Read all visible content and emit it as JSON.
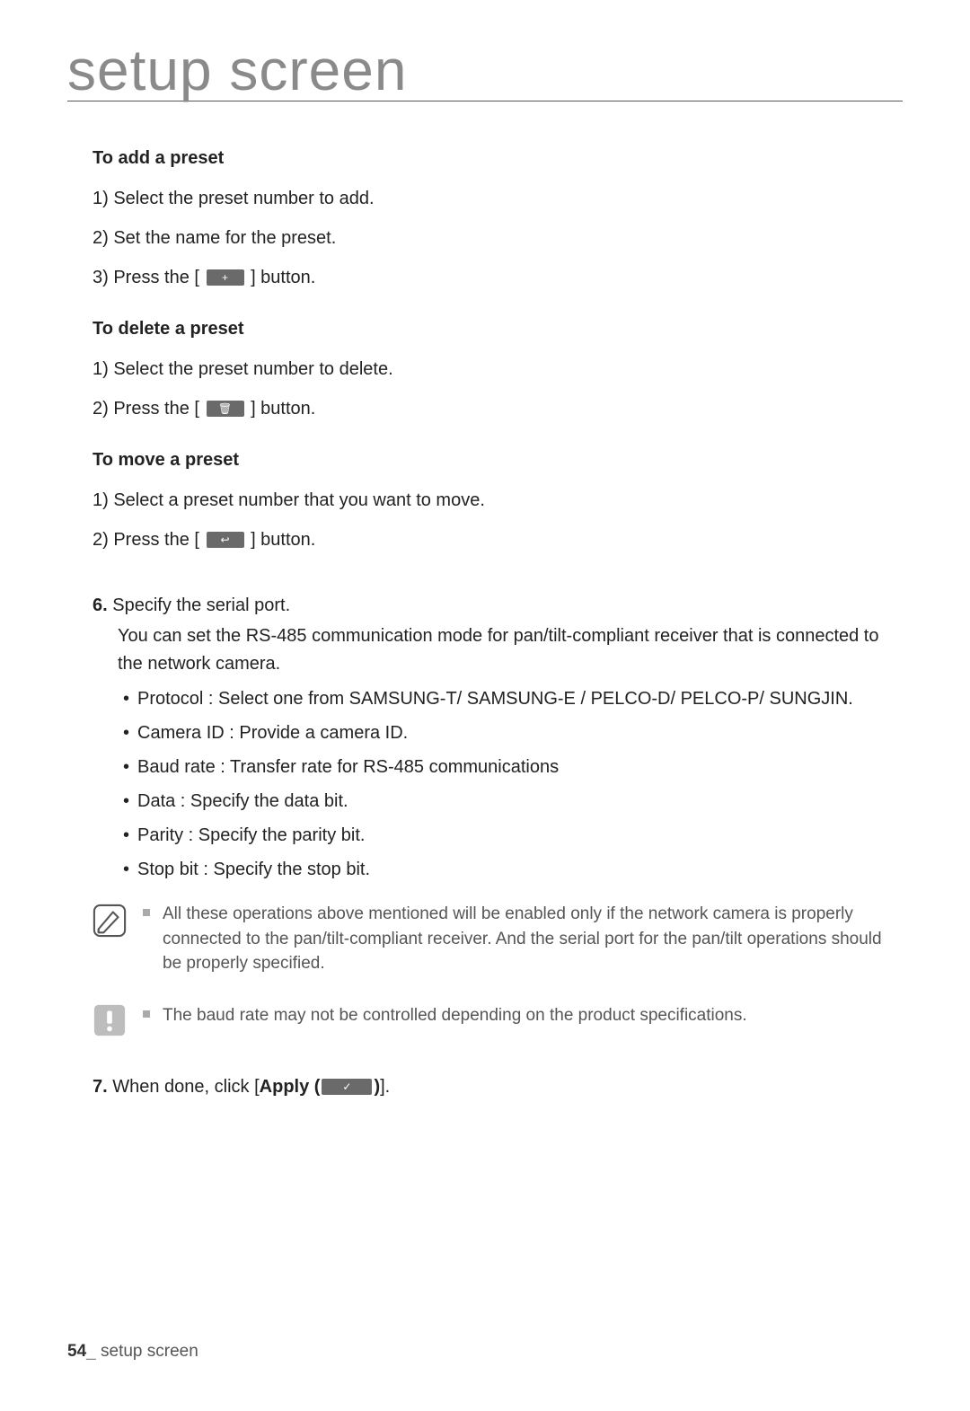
{
  "title": "setup screen",
  "sections": {
    "add": {
      "heading": "To add a preset",
      "steps": [
        "1) Select the preset number to add.",
        "2) Set the name for the preset.",
        "3) Press the [",
        "] button."
      ],
      "btn_glyph": "+"
    },
    "delete": {
      "heading": "To delete a preset",
      "steps": [
        "1) Select the preset number to delete.",
        "2) Press the [",
        "] button."
      ],
      "btn_glyph": "🗑"
    },
    "move": {
      "heading": "To move a preset",
      "steps": [
        "1) Select a preset number that you want to move.",
        "2) Press the [",
        "] button."
      ],
      "btn_glyph": "↩"
    }
  },
  "item6": {
    "label": "6.",
    "title": "Specify the serial port.",
    "desc": "You can set the RS-485 communication mode for pan/tilt-compliant receiver that is connected to the network camera.",
    "bullets": [
      "Protocol : Select one from SAMSUNG-T/ SAMSUNG-E / PELCO-D/ PELCO-P/ SUNGJIN.",
      "Camera ID : Provide a camera ID.",
      "Baud rate : Transfer rate for RS-485 communications",
      "Data : Specify the data bit.",
      "Parity : Specify the parity bit.",
      "Stop bit : Specify the stop bit."
    ]
  },
  "note": "All these operations above mentioned will be enabled only if the network camera is properly connected to the pan/tilt-compliant receiver. And the serial port for the pan/tilt operations should be properly specified.",
  "caution": "The baud rate may not be controlled depending on the product specifications.",
  "item7": {
    "label": "7.",
    "pre": "When done, click [",
    "bold": "Apply (",
    "post": ")",
    "close": "].",
    "btn_glyph": "✓"
  },
  "footer": {
    "page": "54",
    "sep": "_",
    "label": " setup screen"
  }
}
